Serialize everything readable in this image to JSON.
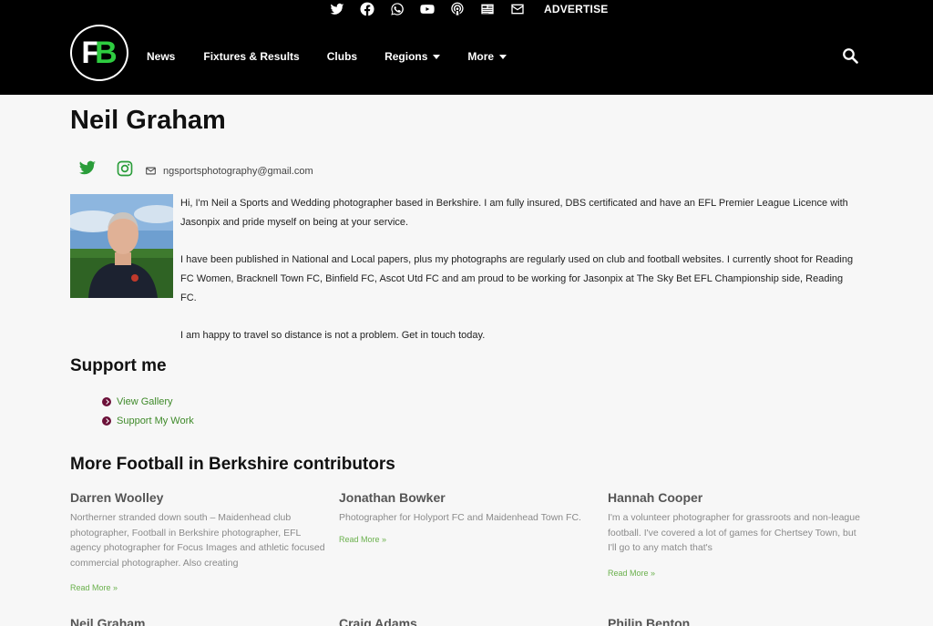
{
  "topbar": {
    "icons": [
      "twitter-icon",
      "facebook-icon",
      "whatsapp-icon",
      "youtube-icon",
      "podcast-icon",
      "newsletter-icon",
      "email-icon"
    ],
    "advertise_label": "ADVERTISE"
  },
  "nav": {
    "items": [
      {
        "label": "News"
      },
      {
        "label": "Fixtures & Results"
      },
      {
        "label": "Clubs"
      },
      {
        "label": "Regions"
      },
      {
        "label": "More"
      }
    ]
  },
  "profile": {
    "name": "Neil Graham",
    "email": "ngsportsphotography@gmail.com",
    "bio": [
      "Hi, I'm Neil a Sports and Wedding photographer based in Berkshire. I am fully insured, DBS certificated and have an EFL Premier League Licence with Jasonpix and pride myself on being at your service.",
      "I have been published in National and Local papers, plus my photographs are regularly used on club and football websites. I currently shoot for Reading FC Women, Bracknell Town FC, Binfield FC, Ascot Utd FC and am proud to be working for Jasonpix at The Sky Bet EFL Championship side, Reading FC.",
      "I am happy to travel so distance is not a problem. Get in touch today."
    ]
  },
  "support": {
    "heading": "Support me",
    "links": [
      {
        "label": "View Gallery"
      },
      {
        "label": "Support My Work"
      }
    ]
  },
  "contributors": {
    "heading": "More Football in Berkshire contributors",
    "read_more": "Read More »",
    "cards": [
      {
        "name": "Darren Woolley",
        "desc": "Northerner stranded down south – Maidenhead club photographer, Football in Berkshire photographer, EFL agency photographer for Focus Images and athletic focused commercial photographer. Also creating"
      },
      {
        "name": "Jonathan Bowker",
        "desc": "Photographer for Holyport FC and Maidenhead Town FC."
      },
      {
        "name": "Hannah Cooper",
        "desc": "I'm a volunteer photographer for grassroots and non-league football. I've covered a lot of games for Chertsey Town, but I'll go to any match that's"
      },
      {
        "name": "Neil Graham",
        "desc": ""
      },
      {
        "name": "Craig Adams",
        "desc": ""
      },
      {
        "name": "Philip Benton",
        "desc": ""
      }
    ]
  },
  "colors": {
    "header_bg": "#000000",
    "link_green": "#3f8a2a",
    "bullet_maroon": "#6b1038",
    "twitter_green": "#2a9d3a"
  }
}
